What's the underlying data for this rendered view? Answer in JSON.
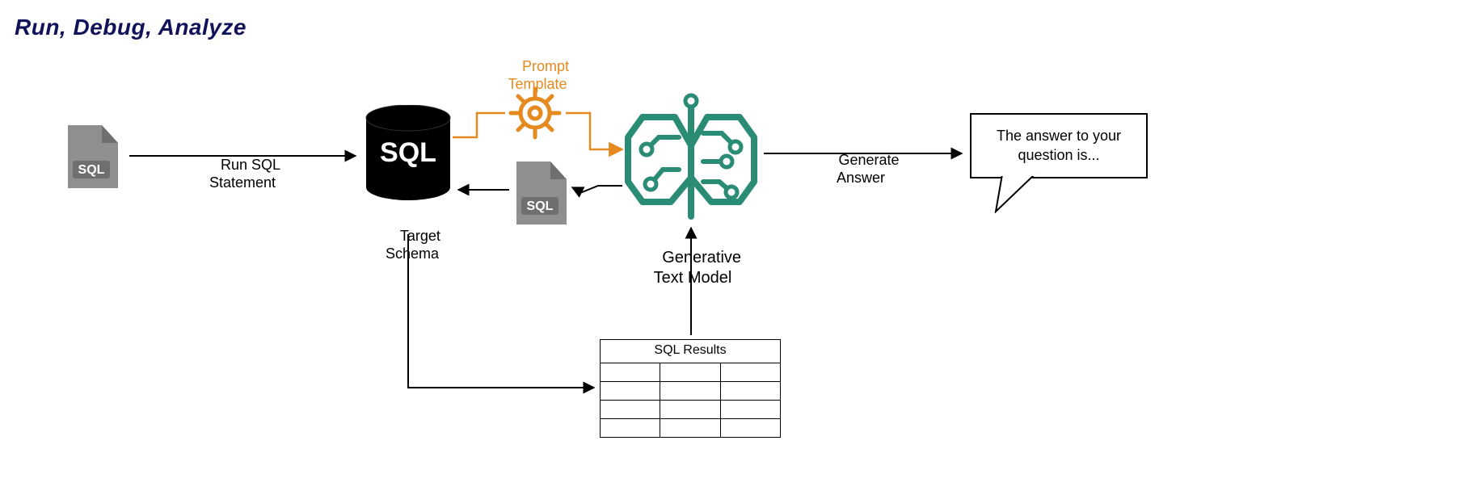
{
  "title": "Run, Debug, Analyze",
  "labels": {
    "run_sql_line1": "Run SQL",
    "run_sql_line2": "Statement",
    "target_schema_line1": "Target",
    "target_schema_line2": "Schema",
    "prompt_template_line1": "Prompt",
    "prompt_template_line2": "Template",
    "gen_model_line1": "Generative",
    "gen_model_line2": "Text Model",
    "generate_answer_line1": "Generate",
    "generate_answer_line2": "Answer",
    "sql_results_header": "SQL Results"
  },
  "speech": "The answer to your question is...",
  "db_text": "SQL",
  "file1_text": "SQL",
  "file2_text": "SQL",
  "colors": {
    "orange": "#e58a1f",
    "teal": "#2a8c75",
    "gray": "#8f8f8f",
    "title": "#12125a"
  }
}
